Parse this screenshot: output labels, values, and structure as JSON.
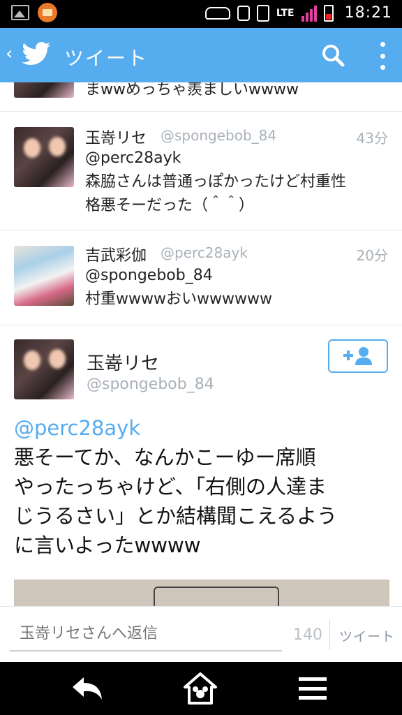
{
  "status_bar": {
    "network": "LTE",
    "time": "18:21",
    "icons": [
      "gallery-icon",
      "folder-icon",
      "car-icon",
      "alarm-icon",
      "vibrate-icon",
      "signal-icon",
      "battery-icon"
    ]
  },
  "action_bar": {
    "title": "ツイート",
    "back_symbol": "‹",
    "accent": "#55acee"
  },
  "timeline": {
    "partial_text": "まwwめっちゃ羨ましいwwww",
    "tweets": [
      {
        "name": "玉嵜リセ",
        "handle": "@spongebob_84",
        "time": "43分",
        "text_line1": "@perc28ayk",
        "text_line2": "森脇さんは普通っぽかったけど村重性",
        "text_line3": "格悪そーだった（＾＾）"
      },
      {
        "name": "吉武彩伽",
        "handle": "@perc28ayk",
        "time": "20分",
        "text_line1": "@spongebob_84",
        "text_line2": "村重wwwwおいwwwwww"
      }
    ]
  },
  "detail": {
    "name": "玉嵜リセ",
    "handle": "@spongebob_84",
    "mention": "@perc28ayk",
    "line1": "悪そーてか、なんかこーゆー席順",
    "line2": "やったっちゃけど、「右側の人達ま",
    "line3": "じうるさい」とか結構聞こえるよう",
    "line4": "に言いよったwwww"
  },
  "reply_bar": {
    "placeholder": "玉嵜リセさんへ返信",
    "count": "140",
    "button": "ツイート"
  }
}
